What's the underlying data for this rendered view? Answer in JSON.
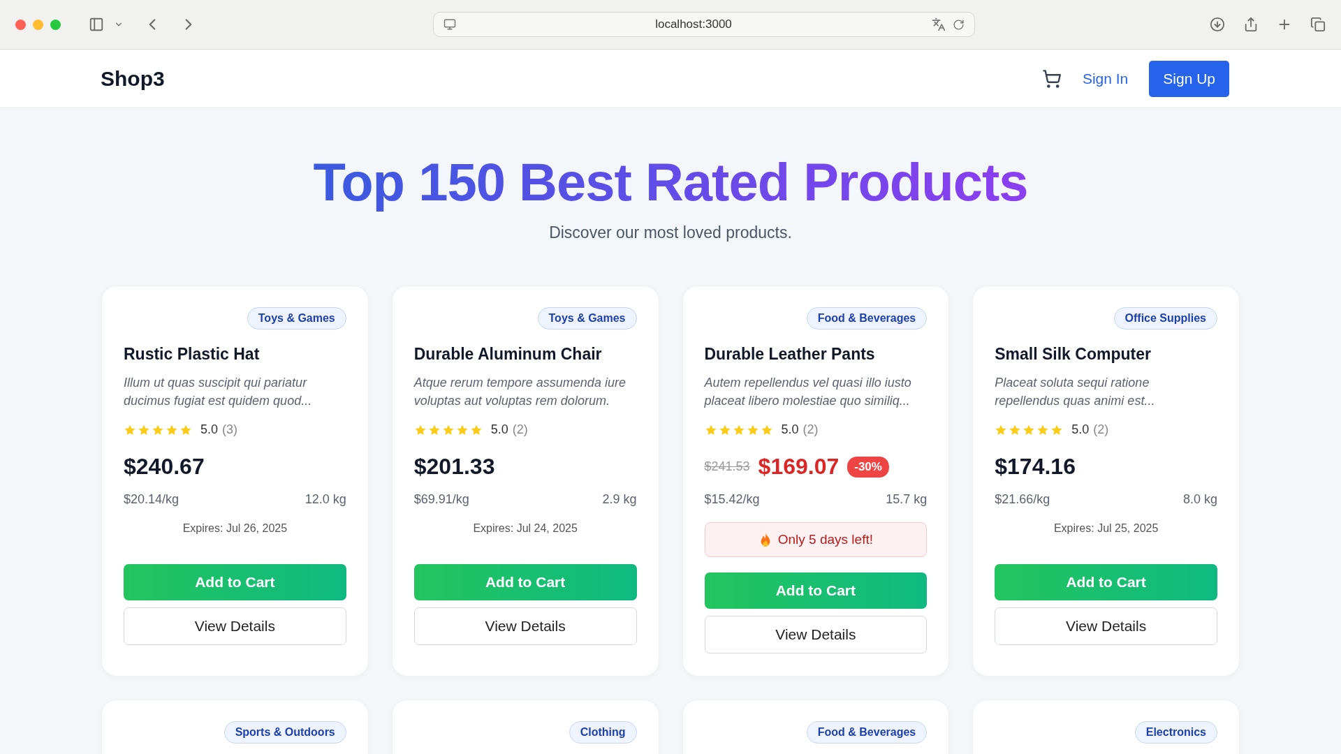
{
  "browser": {
    "address": "localhost:3000"
  },
  "nav": {
    "logo": "Shop3",
    "sign_in": "Sign In",
    "sign_up": "Sign Up"
  },
  "hero": {
    "title": "Top 150 Best Rated Products",
    "subtitle": "Discover our most loved products."
  },
  "products": [
    {
      "category": "Toys & Games",
      "name": "Rustic Plastic Hat",
      "description": "Illum ut quas suscipit qui pariatur ducimus fugiat est quidem quod...",
      "stars": 5,
      "rating": "5.0",
      "reviews": "(3)",
      "price": "$240.67",
      "unit_price": "$20.14/kg",
      "weight": "12.0 kg",
      "notice": {
        "kind": "expires",
        "text": "Expires: Jul 26, 2025"
      },
      "add_label": "Add to Cart",
      "details_label": "View Details"
    },
    {
      "category": "Toys & Games",
      "name": "Durable Aluminum Chair",
      "description": "Atque rerum tempore assumenda iure voluptas aut voluptas rem dolorum.",
      "stars": 5,
      "rating": "5.0",
      "reviews": "(2)",
      "price": "$201.33",
      "unit_price": "$69.91/kg",
      "weight": "2.9 kg",
      "notice": {
        "kind": "expires",
        "text": "Expires: Jul 24, 2025"
      },
      "add_label": "Add to Cart",
      "details_label": "View Details"
    },
    {
      "category": "Food & Beverages",
      "name": "Durable Leather Pants",
      "description": "Autem repellendus vel quasi illo iusto placeat libero molestiae quo similiq...",
      "stars": 5,
      "rating": "5.0",
      "reviews": "(2)",
      "original_price": "$241.53",
      "price": "$169.07",
      "discount": "-30%",
      "unit_price": "$15.42/kg",
      "weight": "15.7 kg",
      "notice": {
        "kind": "urgent",
        "text": "Only 5 days left!"
      },
      "add_label": "Add to Cart",
      "details_label": "View Details"
    },
    {
      "category": "Office Supplies",
      "name": "Small Silk Computer",
      "description": "Placeat soluta sequi ratione repellendus quas animi est...",
      "stars": 5,
      "rating": "5.0",
      "reviews": "(2)",
      "price": "$174.16",
      "unit_price": "$21.66/kg",
      "weight": "8.0 kg",
      "notice": {
        "kind": "expires",
        "text": "Expires: Jul 25, 2025"
      },
      "add_label": "Add to Cart",
      "details_label": "View Details"
    },
    {
      "category": "Sports & Outdoors"
    },
    {
      "category": "Clothing"
    },
    {
      "category": "Food & Beverages"
    },
    {
      "category": "Electronics"
    }
  ]
}
